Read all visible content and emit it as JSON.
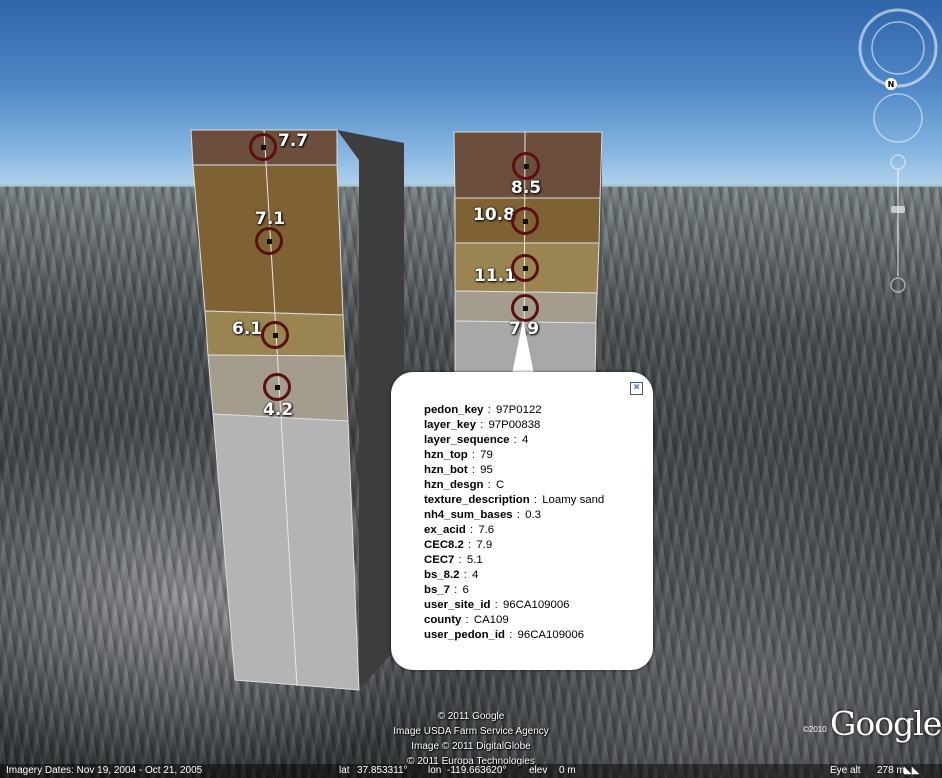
{
  "columns": {
    "left": {
      "labels": [
        "7.7",
        "7.1",
        "6.1",
        "4.2"
      ],
      "colors": [
        "#6b4e3c",
        "#7f6234",
        "#9a8452",
        "#a49c8c",
        "#b4b4b4"
      ]
    },
    "right": {
      "labels": [
        "8.5",
        "10.8",
        "11.1",
        "7.9"
      ],
      "colors": [
        "#6b4e3c",
        "#7f6234",
        "#9a8452",
        "#a49c8c",
        "#a8a8a8"
      ]
    }
  },
  "balloon": {
    "close_icon": "close-icon",
    "attributes": [
      {
        "key": "pedon_key",
        "value": "97P0122"
      },
      {
        "key": "layer_key",
        "value": "97P00838"
      },
      {
        "key": "layer_sequence",
        "value": "4"
      },
      {
        "key": "hzn_top",
        "value": "79"
      },
      {
        "key": "hzn_bot",
        "value": "95"
      },
      {
        "key": "hzn_desgn",
        "value": "C"
      },
      {
        "key": "texture_description",
        "value": "Loamy sand"
      },
      {
        "key": "nh4_sum_bases",
        "value": "0.3"
      },
      {
        "key": "ex_acid",
        "value": "7.6"
      },
      {
        "key": "CEC8.2",
        "value": "7.9"
      },
      {
        "key": "CEC7",
        "value": "5.1"
      },
      {
        "key": "bs_8.2",
        "value": "4"
      },
      {
        "key": "bs_7",
        "value": "6"
      },
      {
        "key": "user_site_id",
        "value": "96CA109006"
      },
      {
        "key": "county",
        "value": "CA109"
      },
      {
        "key": "user_pedon_id",
        "value": "96CA109006"
      }
    ]
  },
  "credits": {
    "line1": "© 2011 Google",
    "line2": "Image USDA Farm Service Agency",
    "line3": "Image © 2011 DigitalGlobe",
    "line4": "© 2011 Europa Technologies"
  },
  "logo": {
    "year": "©2010",
    "text": "Google"
  },
  "statusbar": {
    "imagery_dates": "Imagery Dates: Nov 19, 2004 - Oct 21, 2005",
    "lat_label": "lat",
    "lat": "37.853311°",
    "lon_label": "lon",
    "lon": "-119.663620°",
    "elev_label": "elev",
    "elev": "0 m",
    "eye_label": "Eye alt",
    "eye": "278 m"
  },
  "nav": {
    "north_label": "N"
  }
}
